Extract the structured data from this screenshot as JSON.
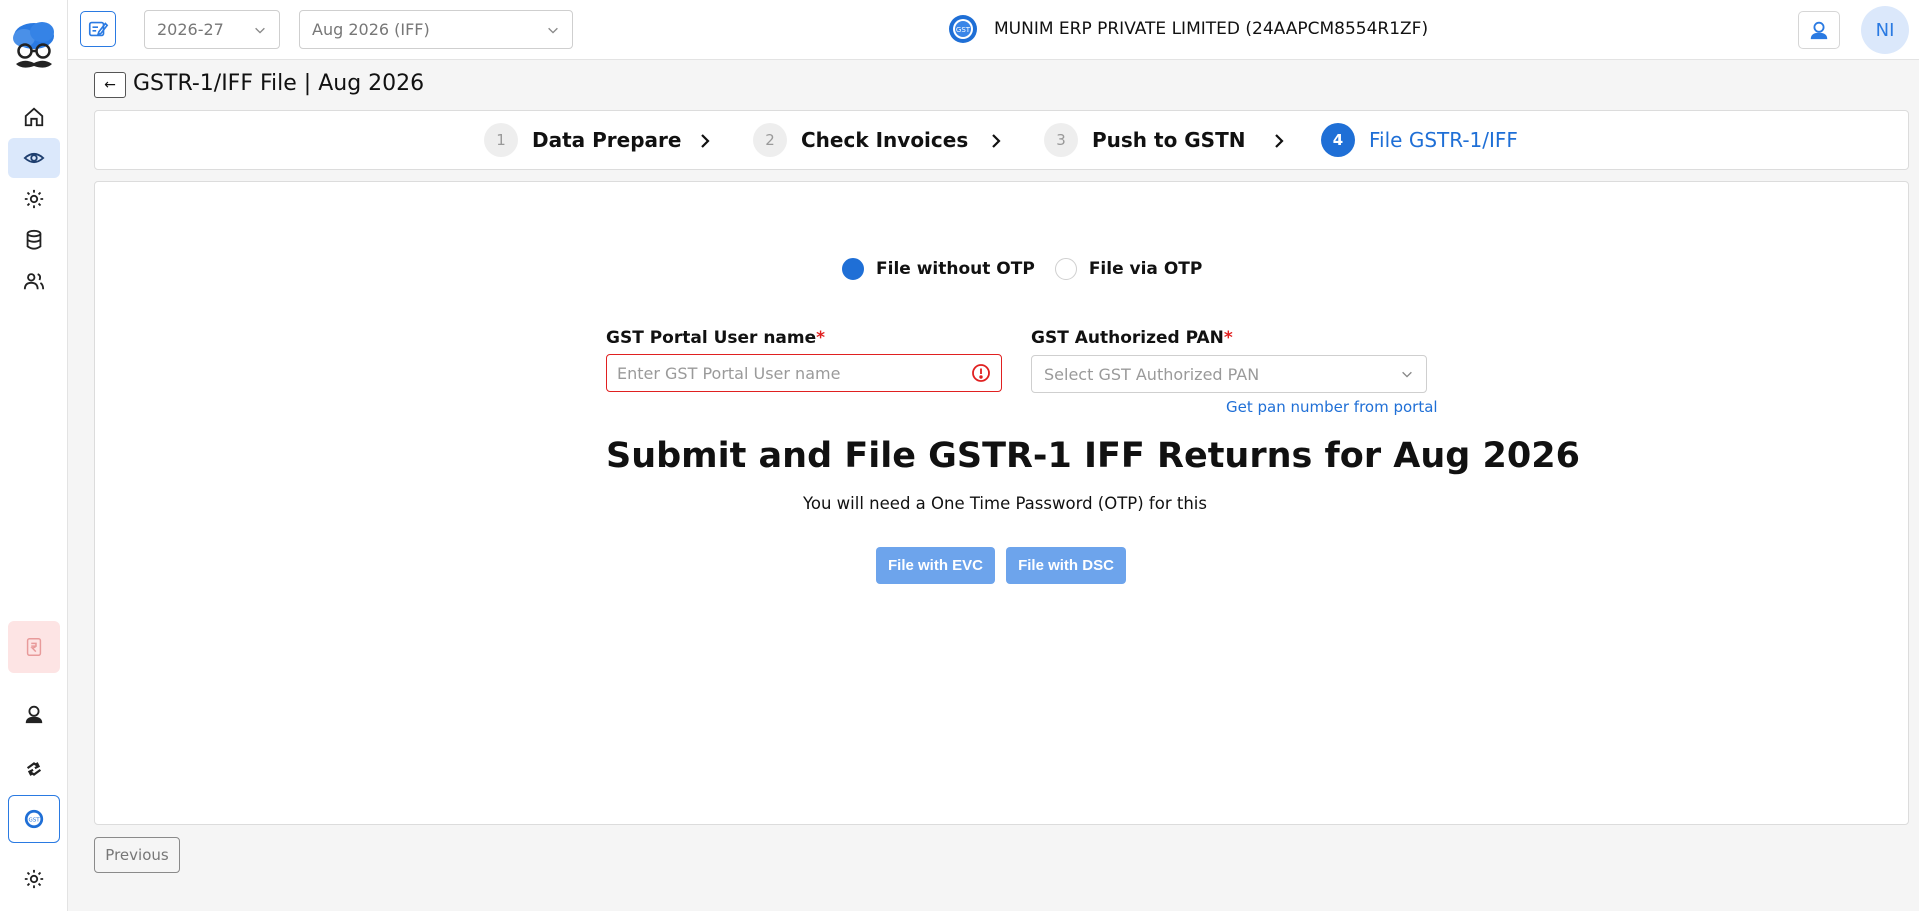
{
  "topbar": {
    "year_select": "2026-27",
    "period_select": "Aug 2026 (IFF)",
    "company_name": "MUNIM ERP PRIVATE LIMITED (24AAPCM8554R1ZF)",
    "avatar_initials": "NI"
  },
  "page": {
    "back_symbol": "←",
    "title": "GSTR-1/IFF File | Aug 2026"
  },
  "stepper": {
    "steps": [
      {
        "num": "1",
        "label": "Data Prepare"
      },
      {
        "num": "2",
        "label": "Check Invoices"
      },
      {
        "num": "3",
        "label": "Push to GSTN"
      },
      {
        "num": "4",
        "label": "File GSTR-1/IFF"
      }
    ]
  },
  "form": {
    "radio_options": [
      "File without OTP",
      "File via OTP"
    ],
    "username_label": "GST Portal User name",
    "username_placeholder": "Enter GST Portal User name",
    "pan_label": "GST Authorized PAN",
    "pan_placeholder": "Select GST Authorized PAN",
    "required_mark": "*",
    "pan_link": "Get pan number from portal"
  },
  "main": {
    "heading": "Submit and File GSTR-1 IFF Returns for Aug 2026",
    "subtext": "You will need a One Time Password (OTP) for this",
    "evc_button": "File with EVC",
    "dsc_button": "File with DSC"
  },
  "footer": {
    "previous_button": "Previous"
  },
  "colors": {
    "accent": "#1f6fd6",
    "error": "#e02020",
    "disabled_button": "#6da4ec"
  }
}
